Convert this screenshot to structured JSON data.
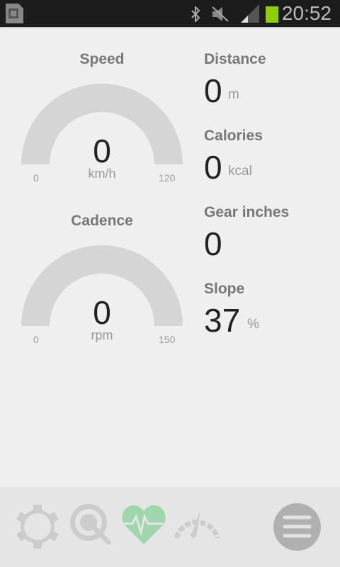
{
  "status_bar": {
    "time": "20:52",
    "battery_color": "#8fcf00"
  },
  "gauges": [
    {
      "label": "Speed",
      "value": "0",
      "unit": "km/h",
      "min": "0",
      "max": "120",
      "fraction": 0
    },
    {
      "label": "Cadence",
      "value": "0",
      "unit": "rpm",
      "min": "0",
      "max": "150",
      "fraction": 0
    }
  ],
  "metrics": [
    {
      "label": "Distance",
      "value": "0",
      "unit": "m"
    },
    {
      "label": "Calories",
      "value": "0",
      "unit": "kcal"
    },
    {
      "label": "Gear inches",
      "value": "0",
      "unit": ""
    },
    {
      "label": "Slope",
      "value": "37",
      "unit": "%"
    }
  ],
  "nav": {
    "active": "heart-rate",
    "accent": "#a0d6ab"
  }
}
